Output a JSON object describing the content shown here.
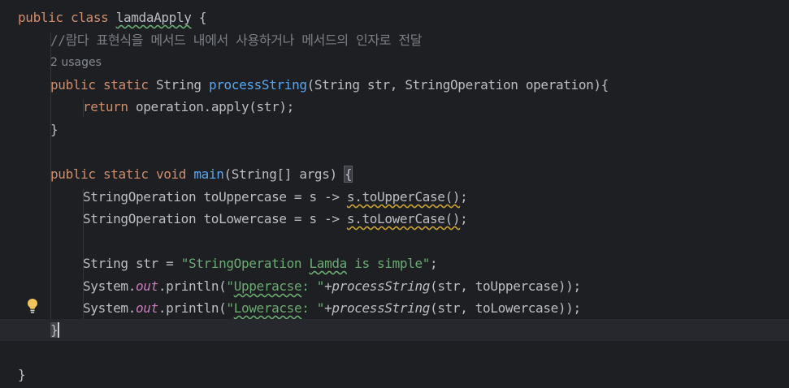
{
  "editor": {
    "codelens": "2 usages",
    "lines": {
      "class_kw": "public class ",
      "class_name": "lamdaApply",
      "class_open": " {",
      "comment": "//람다 표현식을 메서드 내에서 사용하거나 메서드의 인자로 전달",
      "ps_kw": "public static ",
      "ps_type": "String ",
      "ps_name": "processString",
      "ps_params": "(String str, StringOperation operation){",
      "ret_kw": "return",
      "ret_expr": " operation.apply(str);",
      "close1": "}",
      "main_kw": "public static void ",
      "main_name": "main",
      "main_params": "(String[] args) ",
      "main_open": "{",
      "upper_decl": "StringOperation toUppercase = s -> ",
      "upper_body": "s.toUpperCase()",
      "upper_end": ";",
      "lower_decl": "StringOperation toLowercase = s -> ",
      "lower_body": "s.toLowerCase()",
      "lower_end": ";",
      "str_decl": "String str = ",
      "str_q1": "\"StringOperation ",
      "str_typo": "Lamda",
      "str_q2": " is simple\"",
      "str_end": ";",
      "p1_sys": "System.",
      "p1_out": "out",
      "p1_println": ".println(",
      "p1_q": "\"",
      "p1_typo": "Upperacse",
      "p1_rest": ": \"",
      "p1_plus": "+",
      "p1_call": "processString",
      "p1_args": "(str, toUppercase));",
      "p2_sys": "System.",
      "p2_out": "out",
      "p2_println": ".println(",
      "p2_q": "\"",
      "p2_typo": "Loweracse",
      "p2_rest": ": \"",
      "p2_plus": "+",
      "p2_call": "processString",
      "p2_args": "(str, toLowercase));",
      "close_main": "}",
      "close_class": "}"
    }
  }
}
